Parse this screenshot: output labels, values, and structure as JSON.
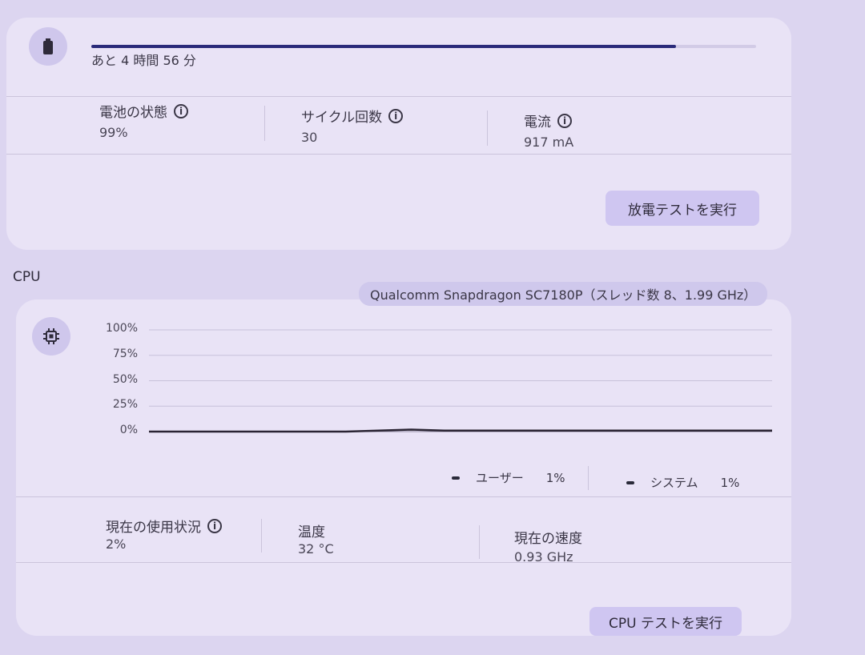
{
  "battery": {
    "time_remaining": "あと 4 時間 56 分",
    "level_fraction": 0.88,
    "stats": [
      {
        "label": "電池の状態",
        "value": "99%",
        "has_info": true
      },
      {
        "label": "サイクル回数",
        "value": "30",
        "has_info": true
      },
      {
        "label": "電流",
        "value": "917 mA",
        "has_info": true
      }
    ],
    "test_button": "放電テストを実行",
    "icon": "battery-icon"
  },
  "cpu": {
    "section_title": "CPU",
    "processor_chip": "Qualcomm Snapdragon SC7180P（スレッド数 8、1.99 GHz）",
    "icon": "cpu-chip-icon",
    "legend": [
      {
        "name": "ユーザー",
        "value": "1%"
      },
      {
        "name": "システム",
        "value": "1%"
      }
    ],
    "stats": [
      {
        "label": "現在の使用状況",
        "value": "2%",
        "has_info": true
      },
      {
        "label": "温度",
        "value": "32 °C",
        "has_info": false
      },
      {
        "label": "現在の速度",
        "value": "0.93 GHz",
        "has_info": false
      }
    ],
    "test_button": "CPU テストを実行"
  },
  "chart_data": {
    "type": "line",
    "yticks": [
      "100%",
      "75%",
      "50%",
      "25%",
      "0%"
    ],
    "ylim": [
      0,
      100
    ],
    "grid": true,
    "legend_position": "bottom-right",
    "series": [
      {
        "name": "ユーザー",
        "values": [
          0,
          0,
          0,
          0,
          0,
          0,
          0,
          1,
          2,
          1,
          1,
          1,
          1,
          1,
          1,
          1,
          1,
          1,
          1,
          1
        ]
      }
    ]
  },
  "colors": {
    "background": "#dcd5f0",
    "card": "#e9e3f6",
    "accent": "#2a2a7a",
    "button": "#cfc6f1"
  }
}
